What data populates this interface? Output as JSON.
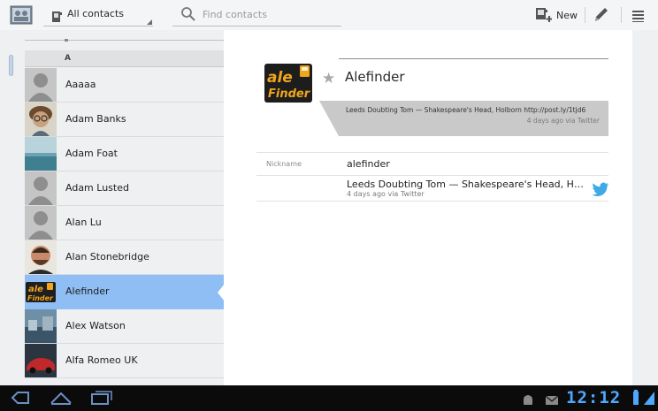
{
  "header": {
    "filter_label": "All contacts",
    "search_placeholder": "Find contacts",
    "new_label": "New"
  },
  "list": {
    "section_letter": "A",
    "contacts": [
      {
        "name": "Aaaaa"
      },
      {
        "name": "Adam Banks"
      },
      {
        "name": "Adam Foat"
      },
      {
        "name": "Adam Lusted"
      },
      {
        "name": "Alan Lu"
      },
      {
        "name": "Alan Stonebridge"
      },
      {
        "name": "Alefinder",
        "selected": true
      },
      {
        "name": "Alex Watson"
      },
      {
        "name": "Alfa Romeo UK"
      }
    ]
  },
  "detail": {
    "name": "Alefinder",
    "logo_text_1": "ale",
    "logo_text_2": "Finder",
    "status_text": "Leeds Doubting Tom — Shakespeare's Head, Holborn http://post.ly/1tjd6",
    "status_meta": "4 days ago via Twitter",
    "nickname_label": "Nickname",
    "nickname_value": "alefinder",
    "status_line": "Leeds Doubting Tom — Shakespeare's Head, Holborn ...",
    "status_line_meta": "4 days ago via Twitter"
  },
  "statusbar": {
    "clock": "12:12"
  },
  "colors": {
    "selection": "#8ebef3",
    "clock": "#4fa8ff",
    "twitter": "#3fa9e8"
  }
}
